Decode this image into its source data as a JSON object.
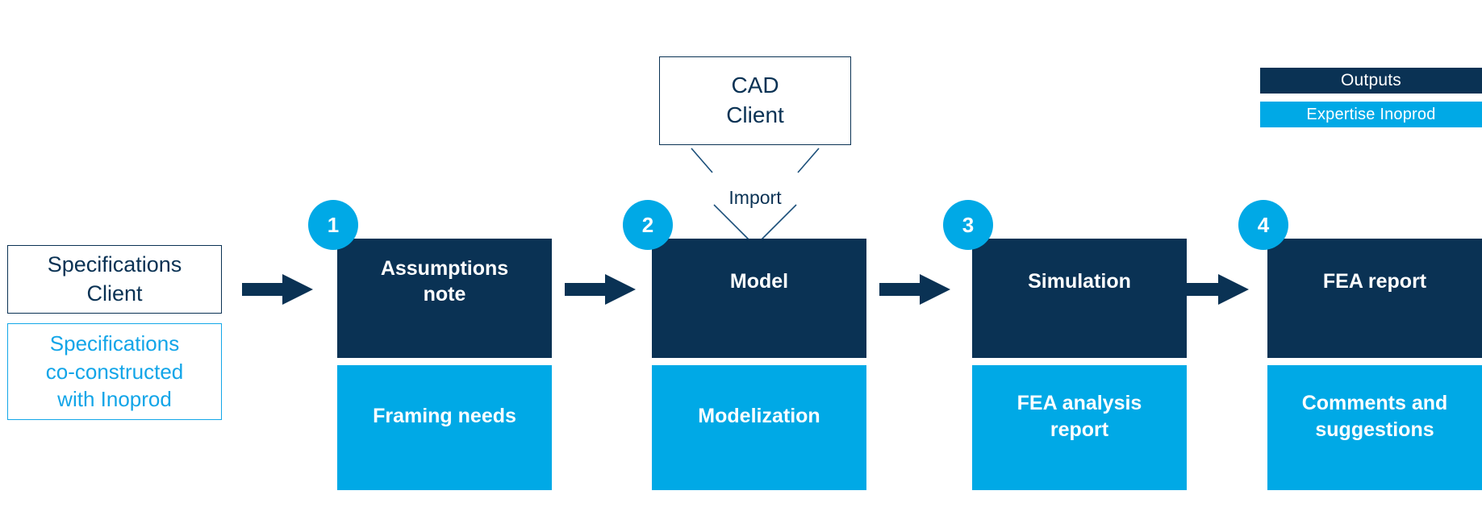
{
  "legend": {
    "items": [
      {
        "label": "Outputs",
        "color": "#0a3254"
      },
      {
        "label": "Expertise Inoprod",
        "color": "#00a9e6"
      }
    ]
  },
  "inputs": {
    "client_spec": "Specifications\nClient",
    "coconstructed_spec": "Specifications\nco-constructed\nwith Inoprod"
  },
  "source": {
    "cad_box": "CAD\nClient",
    "import_label": "Import"
  },
  "stages": [
    {
      "number": "1",
      "output": "Assumptions\nnote",
      "expertise": "Framing needs"
    },
    {
      "number": "2",
      "output": "Model",
      "expertise": "Modelization"
    },
    {
      "number": "3",
      "output": "Simulation",
      "expertise": "FEA analysis\nreport"
    },
    {
      "number": "4",
      "output": "FEA report",
      "expertise": "Comments and\nsuggestions"
    }
  ],
  "colors": {
    "navy": "#0a3254",
    "blue": "#00a9e6",
    "white": "#ffffff"
  }
}
